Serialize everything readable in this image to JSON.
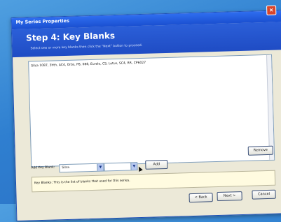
{
  "window": {
    "title": "My Series Properties",
    "close_glyph": "×"
  },
  "banner": {
    "title": "Step 4: Key Blanks",
    "description": "Select one or more key blanks then click the \"Next\" button to proceed."
  },
  "list": {
    "items": [
      "Silca 1087, 3hth, AC4, Orbs, P8, 088, Eurelo, CS, Lotus, SC4, RR, CP6027"
    ]
  },
  "buttons": {
    "remove": "Remove",
    "add": "Add",
    "back": "< Back",
    "next": "Next >",
    "cancel": "Cancel"
  },
  "add_row": {
    "label": "Add Key Blank:",
    "manufacturer_value": "Silca",
    "blank_value": ""
  },
  "info": {
    "text": "Key Blanks: This is the list of blanks that used for this series."
  }
}
